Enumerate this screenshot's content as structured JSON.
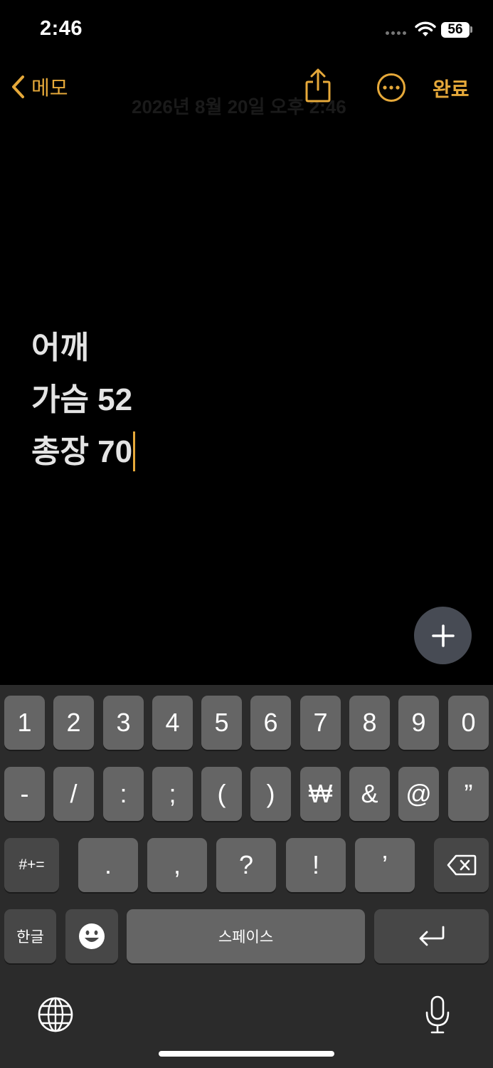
{
  "status_bar": {
    "time": "2:46",
    "battery": "56"
  },
  "nav": {
    "back_label": "메모",
    "done_label": "완료",
    "faded_date": "2026년 8월 20일 오후 2:46"
  },
  "note": {
    "lines": [
      "어깨",
      "가슴 52",
      "총장 70"
    ]
  },
  "keyboard": {
    "row1": [
      "1",
      "2",
      "3",
      "4",
      "5",
      "6",
      "7",
      "8",
      "9",
      "0"
    ],
    "row2": [
      "-",
      "/",
      ":",
      ";",
      "(",
      ")",
      "₩",
      "&",
      "@",
      "”"
    ],
    "row3_mode": "#+=",
    "row3": [
      ".",
      ",",
      "?",
      "!",
      "’"
    ],
    "lang_key": "한글",
    "space_label": "스페이스"
  },
  "icons": {
    "back": "chevron-left-icon",
    "share": "share-icon",
    "more": "ellipsis-circle-icon",
    "add": "plus-icon",
    "delete": "backspace-icon",
    "return": "return-icon",
    "emoji": "emoji-icon",
    "globe": "globe-icon",
    "mic": "microphone-icon"
  },
  "colors": {
    "accent": "#e6a93a",
    "background": "#000000",
    "keyboard_bg": "#2b2b2b"
  }
}
